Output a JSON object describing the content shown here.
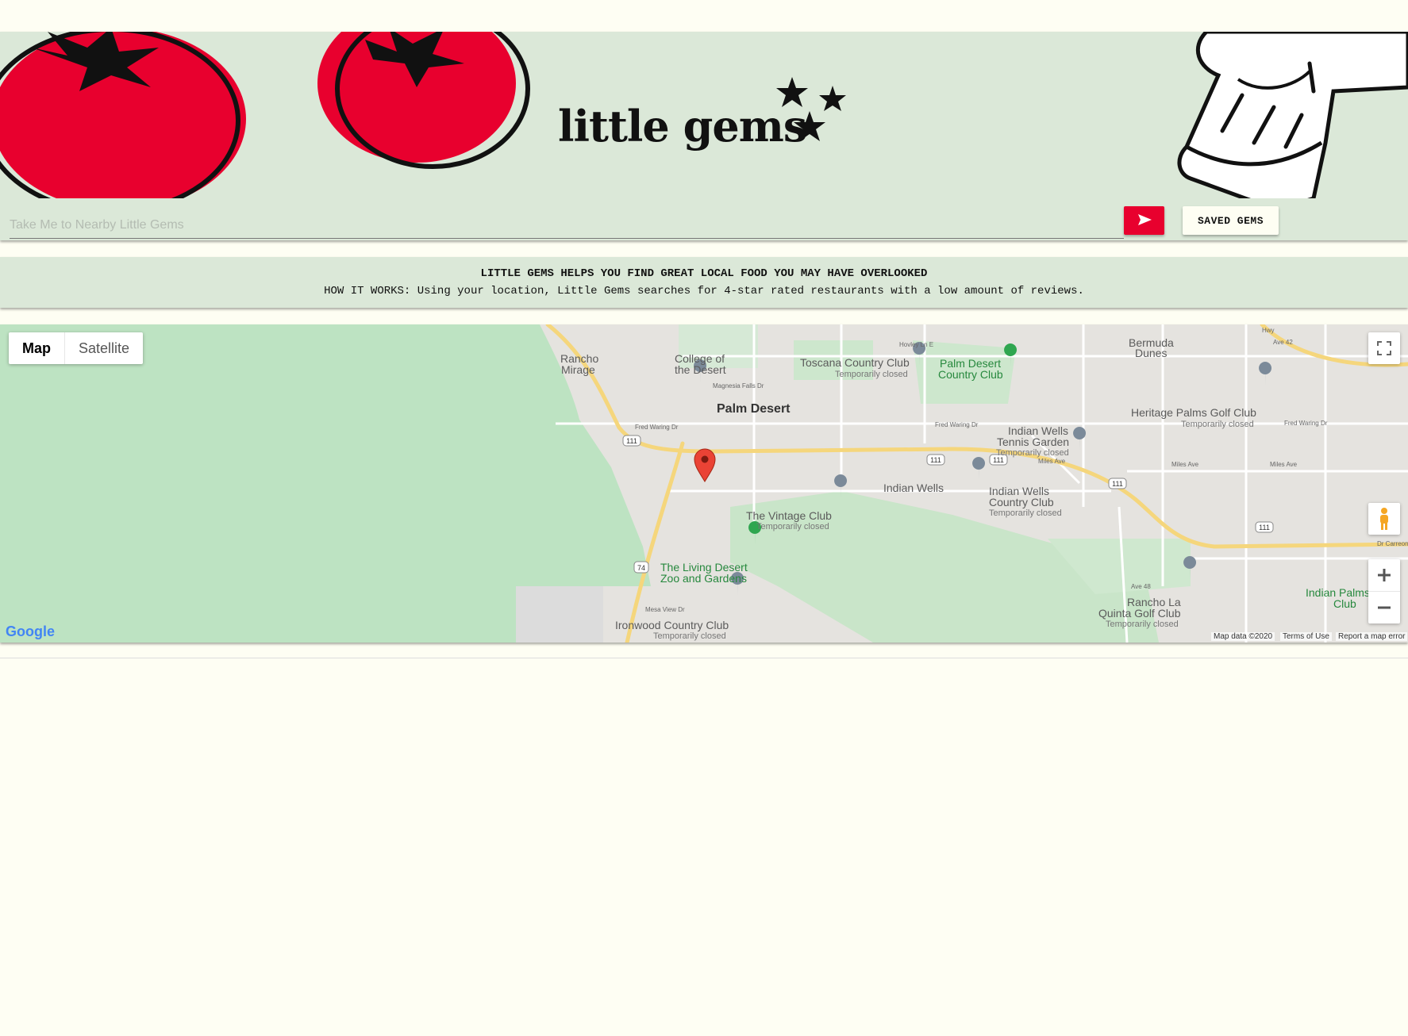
{
  "brand": {
    "title": "little gems"
  },
  "search": {
    "placeholder": "Take Me to Nearby Little Gems"
  },
  "saved_button_label": "SAVED GEMS",
  "info": {
    "headline": "LITTLE GEMS HELPS YOU FIND GREAT LOCAL FOOD YOU MAY HAVE OVERLOOKED",
    "how_it_works": "HOW IT WORKS: Using your location, Little Gems searches for 4-star rated restaurants with a low amount of reviews."
  },
  "map": {
    "type_tabs": [
      "Map",
      "Satellite"
    ],
    "places": {
      "palm_desert": "Palm Desert",
      "rancho_mirage_1": "Rancho",
      "rancho_mirage_2": "Mirage",
      "college_1": "College of",
      "college_2": "the Desert",
      "toscana": "Toscana Country Club",
      "toscana_status": "Temporarily closed",
      "palm_desert_cc_1": "Palm Desert",
      "palm_desert_cc_2": "Country Club",
      "bermuda_1": "Bermuda",
      "bermuda_2": "Dunes",
      "heritage": "Heritage Palms Golf Club",
      "heritage_status": "Temporarily closed",
      "iw_tennis_1": "Indian Wells",
      "iw_tennis_2": "Tennis Garden",
      "iw_tennis_status": "Temporarily closed",
      "indian_wells": "Indian Wells",
      "iw_cc_1": "Indian Wells",
      "iw_cc_2": "Country Club",
      "iw_cc_status": "Temporarily closed",
      "vintage": "The Vintage Club",
      "vintage_status": "Temporarily closed",
      "living_desert_1": "The Living Desert",
      "living_desert_2": "Zoo and Gardens",
      "ironwood": "Ironwood Country Club",
      "ironwood_status": "Temporarily closed",
      "rancho_la_quinta_1": "Rancho La",
      "rancho_la_quinta_2": "Quinta Golf Club",
      "rancho_la_quinta_status": "Temporarily closed",
      "indian_palms_1": "Indian Palms",
      "indian_palms_2": "Club"
    },
    "streets": {
      "fred_waring": "Fred Waring Dr",
      "fred_waring_2": "Fred Waring Dr",
      "fred_waring_3": "Fred Waring Dr",
      "magnesia": "Magnesia Falls Dr",
      "hovley": "Hovley Ln E",
      "miles_ave": "Miles Ave",
      "miles_ave_2": "Miles Ave",
      "miles_ave_3": "Miles Ave",
      "ave_42": "Ave 42",
      "ave_48": "Ave 48",
      "mesa_view": "Mesa View Dr",
      "dr_carreon": "Dr Carreon",
      "hwy": "Hwy"
    },
    "shields": {
      "r111": "111",
      "r74": "74"
    },
    "logo": "Google",
    "footer": {
      "map_data": "Map data ©2020",
      "terms": "Terms of Use",
      "report": "Report a map error"
    }
  }
}
